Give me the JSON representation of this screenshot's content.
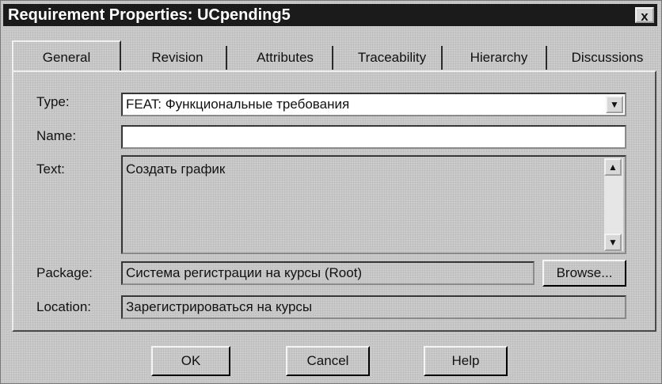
{
  "window": {
    "title": "Requirement Properties: UCpending5",
    "close_glyph": "x"
  },
  "tabs": [
    {
      "label": "General",
      "active": true
    },
    {
      "label": "Revision",
      "active": false
    },
    {
      "label": "Attributes",
      "active": false
    },
    {
      "label": "Traceability",
      "active": false
    },
    {
      "label": "Hierarchy",
      "active": false
    },
    {
      "label": "Discussions",
      "active": false
    }
  ],
  "form": {
    "type_label": "Type:",
    "type_value": "FEAT: Функциональные требования",
    "name_label": "Name:",
    "name_value": "",
    "text_label": "Text:",
    "text_value": "Создать график",
    "package_label": "Package:",
    "package_value": "Система регистрации на курсы (Root)",
    "browse_label": "Browse...",
    "location_label": "Location:",
    "location_value": "Зарегистрироваться на курсы"
  },
  "buttons": {
    "ok": "OK",
    "cancel": "Cancel",
    "help": "Help"
  },
  "icons": {
    "dropdown": "chevron-down-icon",
    "scroll_up": "arrow-up-icon",
    "scroll_down": "arrow-down-icon"
  }
}
